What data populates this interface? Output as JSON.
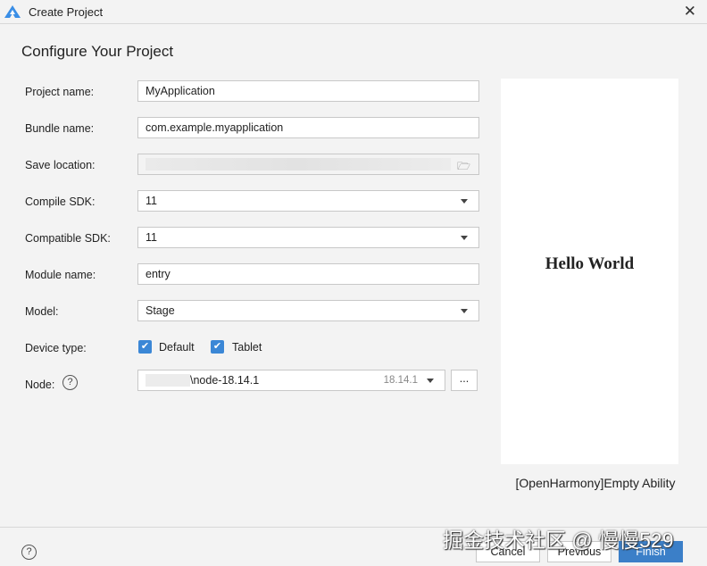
{
  "window": {
    "title": "Create Project",
    "close_icon": "close-icon",
    "app_icon": "deveco-logo-icon"
  },
  "heading": "Configure Your Project",
  "form": {
    "project_name": {
      "label": "Project name:",
      "value": "MyApplication"
    },
    "bundle_name": {
      "label": "Bundle name:",
      "value": "com.example.myapplication"
    },
    "save_location": {
      "label": "Save location:",
      "value": ""
    },
    "compile_sdk": {
      "label": "Compile SDK:",
      "value": "11"
    },
    "compatible_sdk": {
      "label": "Compatible SDK:",
      "value": "11"
    },
    "module_name": {
      "label": "Module name:",
      "value": "entry"
    },
    "model": {
      "label": "Model:",
      "value": "Stage"
    },
    "device_type": {
      "label": "Device type:",
      "options": [
        {
          "label": "Default",
          "checked": true
        },
        {
          "label": "Tablet",
          "checked": true
        }
      ]
    },
    "node": {
      "label": "Node:",
      "value": "\\node-18.14.1",
      "version": "18.14.1",
      "browse": "..."
    }
  },
  "preview": {
    "text": "Hello World",
    "template": "[OpenHarmony]Empty Ability"
  },
  "buttons": {
    "cancel": "Cancel",
    "previous": "Previous",
    "finish": "Finish"
  },
  "watermark": "掘金技术社区 @ 慢慢529",
  "colors": {
    "accent": "#3b7fc8"
  }
}
